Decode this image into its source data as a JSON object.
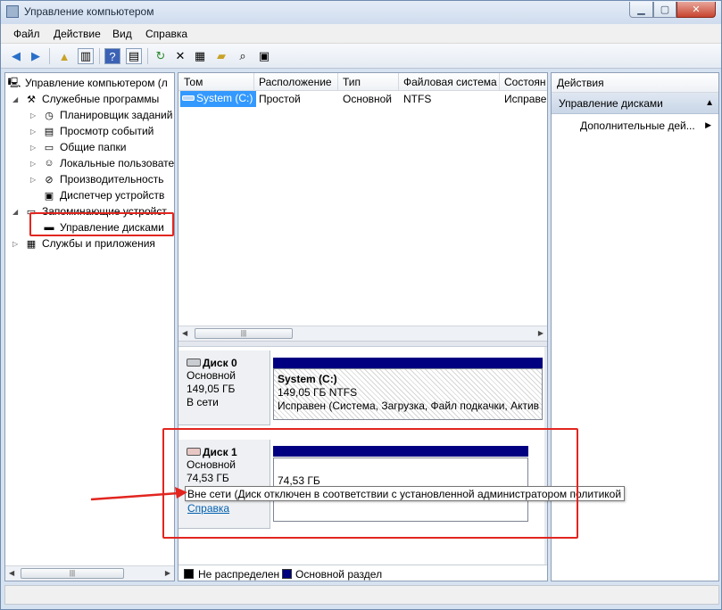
{
  "window": {
    "title": "Управление компьютером"
  },
  "menu": {
    "file": "Файл",
    "action": "Действие",
    "view": "Вид",
    "help": "Справка"
  },
  "toolbar": {
    "buttons": [
      "back-icon",
      "forward-icon",
      "up-folder-icon",
      "show-hide-tree-icon",
      "help-icon",
      "show-hide-action-pane-icon",
      "refresh-icon",
      "delete-icon",
      "properties-icon",
      "open-icon",
      "search-icon",
      "rescan-icon"
    ]
  },
  "tree": {
    "root": "Управление компьютером (л",
    "system_tools": "Служебные программы",
    "task_scheduler": "Планировщик заданий",
    "event_viewer": "Просмотр событий",
    "shared_folders": "Общие папки",
    "local_users": "Локальные пользовате",
    "performance": "Производительность",
    "device_manager": "Диспетчер устройств",
    "storage": "Запоминающие устройст",
    "disk_management": "Управление дисками",
    "services": "Службы и приложения"
  },
  "volumes": {
    "columns": [
      "Том",
      "Расположение",
      "Тип",
      "Файловая система",
      "Состоян"
    ],
    "rows": [
      {
        "name": "System (C:)",
        "layout": "Простой",
        "type": "Основной",
        "fs": "NTFS",
        "status": "Исправе"
      }
    ]
  },
  "disks": [
    {
      "name": "Диск 0",
      "kind": "Основной",
      "size": "149,05 ГБ",
      "state": "В сети",
      "partition": {
        "title": "System  (C:)",
        "size": "149,05 ГБ NTFS",
        "status": "Исправен (Система, Загрузка, Файл подкачки, Актив"
      }
    },
    {
      "name": "Диск 1",
      "kind": "Основной",
      "size": "74,53 ГБ",
      "partition": {
        "size": "74,53 ГБ"
      }
    }
  ],
  "tooltip": "Вне сети (Диск отключен в соответствии с установленной администратором политикой",
  "help_link": "Справка",
  "legend": {
    "unallocated": "Не распределен",
    "primary": "Основной раздел"
  },
  "colors": {
    "primary_partition": "#000080",
    "unallocated": "#000000",
    "selection": "#3399ff",
    "annotation": "#e2251f"
  },
  "actions": {
    "header": "Действия",
    "section": "Управление дисками",
    "more": "Дополнительные дей..."
  }
}
